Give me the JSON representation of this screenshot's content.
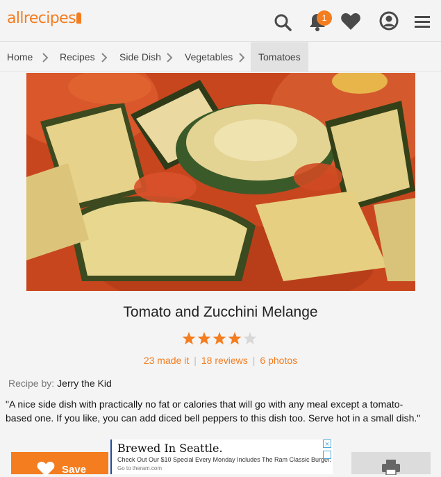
{
  "header": {
    "logo_text": "allrecipes",
    "notification_count": "1",
    "brand_color": "#f47d20",
    "icons": [
      "search-icon",
      "bell-icon",
      "heart-icon",
      "user-icon",
      "menu-icon"
    ]
  },
  "breadcrumb": {
    "items": [
      {
        "label": "Home"
      },
      {
        "label": "Recipes"
      },
      {
        "label": "Side Dish"
      },
      {
        "label": "Vegetables"
      },
      {
        "label": "Tomatoes"
      }
    ]
  },
  "recipe": {
    "title": "Tomato and Zucchini Melange",
    "rating": 4,
    "rating_max": 5,
    "made_it": "23 made it",
    "reviews": "18 reviews",
    "photos": "6 photos",
    "byline_label": "Recipe by:",
    "author": "Jerry the Kid",
    "description": "\"A nice side dish with practically no fat or calories that will go with any meal except a tomato-based one. If you like, you can add diced bell peppers to this dish too. Serve hot in a small dish.\""
  },
  "actions": {
    "save_label": "Save"
  },
  "ad": {
    "headline": "Brewed In Seattle.",
    "subtext": "Check Out Our $10 Special Every Monday Includes The Ram Classic Burger.",
    "url": "Go to theram.com"
  }
}
